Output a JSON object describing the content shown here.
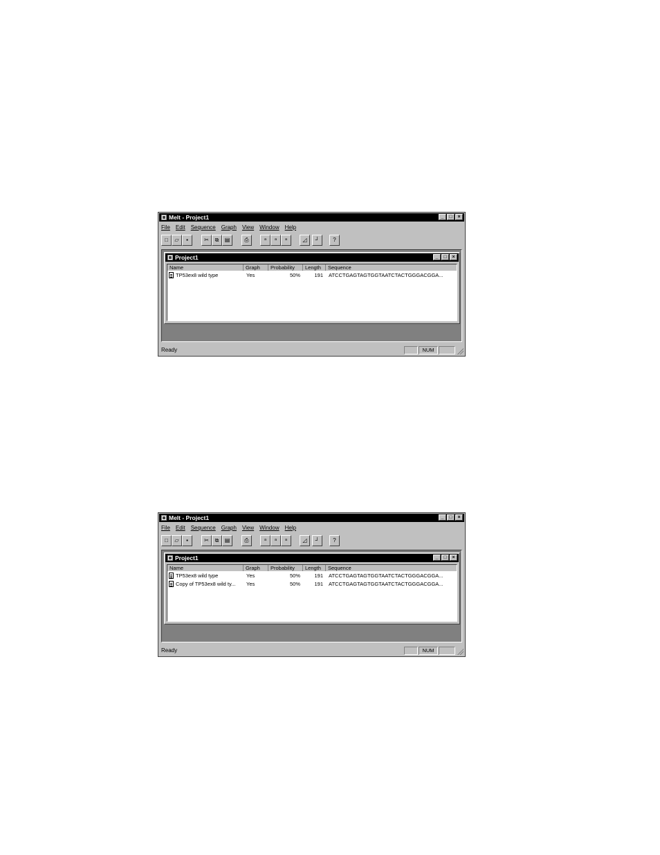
{
  "screenshots": [
    {
      "app_title": "Melt - Project1",
      "menu": [
        "File",
        "Edit",
        "Sequence",
        "Graph",
        "View",
        "Window",
        "Help"
      ],
      "toolbar_icons": [
        "new-icon",
        "open-icon",
        "save-icon",
        "cut-icon",
        "copy-icon",
        "paste-icon",
        "print-icon",
        "sequence-tool-1-icon",
        "sequence-tool-2-icon",
        "sequence-tool-3-icon",
        "graph-icon",
        "step-graph-icon",
        "help-icon"
      ],
      "child_title": "Project1",
      "columns": [
        "Name",
        "Graph",
        "Probability",
        "Length",
        "Sequence"
      ],
      "rows": [
        {
          "name": "TP53ex8 wild type",
          "graph": "Yes",
          "probability": "50%",
          "length": "191",
          "sequence": "ATCCTGAGTAGTGGTAATCTACTGGGACGGA..."
        }
      ],
      "status_text": "Ready",
      "status_num": "NUM"
    },
    {
      "app_title": "Melt - Project1",
      "menu": [
        "File",
        "Edit",
        "Sequence",
        "Graph",
        "View",
        "Window",
        "Help"
      ],
      "toolbar_icons": [
        "new-icon",
        "open-icon",
        "save-icon",
        "cut-icon",
        "copy-icon",
        "paste-icon",
        "print-icon",
        "sequence-tool-1-icon",
        "sequence-tool-2-icon",
        "sequence-tool-3-icon",
        "graph-icon",
        "step-graph-icon",
        "help-icon"
      ],
      "child_title": "Project1",
      "columns": [
        "Name",
        "Graph",
        "Probability",
        "Length",
        "Sequence"
      ],
      "rows": [
        {
          "name": "TP53ex8 wild type",
          "graph": "Yes",
          "probability": "50%",
          "length": "191",
          "sequence": "ATCCTGAGTAGTGGTAATCTACTGGGACGGA..."
        },
        {
          "name": "Copy of TP53ex8 wild ty...",
          "graph": "Yes",
          "probability": "50%",
          "length": "191",
          "sequence": "ATCCTGAGTAGTGGTAATCTACTGGGACGGA..."
        }
      ],
      "status_text": "Ready",
      "status_num": "NUM"
    }
  ]
}
